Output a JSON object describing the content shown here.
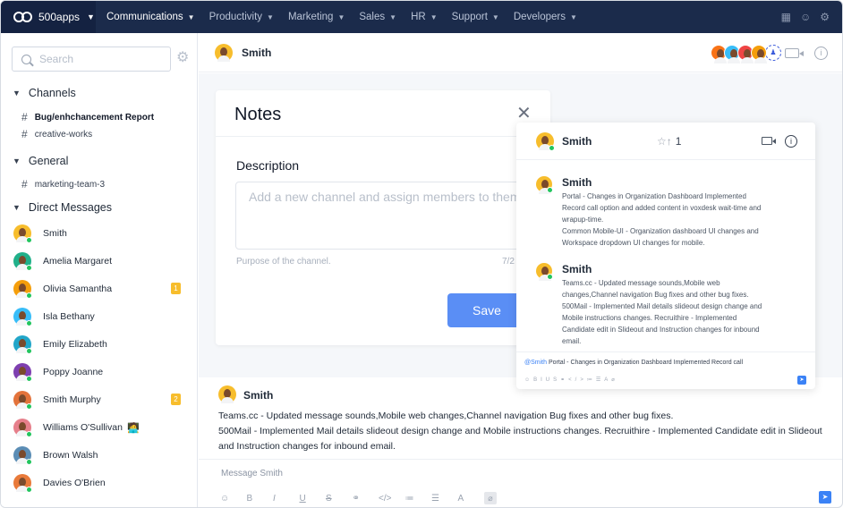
{
  "brand": {
    "name": "500apps"
  },
  "nav": [
    {
      "label": "Communications"
    },
    {
      "label": "Productivity"
    },
    {
      "label": "Marketing"
    },
    {
      "label": "Sales"
    },
    {
      "label": "HR"
    },
    {
      "label": "Support"
    },
    {
      "label": "Developers"
    }
  ],
  "top_icons": [
    "apps-grid-icon",
    "support-icon",
    "gear-icon"
  ],
  "sidebar": {
    "search_placeholder": "Search",
    "channels_title": "Channels",
    "channels": [
      {
        "label": "Bug/enhchancement Report",
        "bold": true
      },
      {
        "label": "creative-works",
        "bold": false
      }
    ],
    "general_title": "General",
    "general": [
      {
        "label": "marketing-team-3"
      }
    ],
    "dm_title": "Direct Messages",
    "dms": [
      {
        "name": "Smith",
        "bg": "#f7bd2c",
        "badge": ""
      },
      {
        "name": "Amelia Margaret",
        "bg": "#20b08a",
        "badge": ""
      },
      {
        "name": "Olivia Samantha",
        "bg": "#f59e0b",
        "badge": "1"
      },
      {
        "name": "Isla Bethany",
        "bg": "#38bdf8",
        "badge": ""
      },
      {
        "name": "Emily Elizabeth",
        "bg": "#22a6c9",
        "badge": ""
      },
      {
        "name": "Poppy Joanne",
        "bg": "#7e3fb0",
        "badge": ""
      },
      {
        "name": "Smith Murphy",
        "bg": "#e3733b",
        "badge": "2"
      },
      {
        "name": "Williams O'Sullivan",
        "bg": "#e67f8b",
        "badge": "",
        "emoji": "🧑‍💻"
      },
      {
        "name": "Brown Walsh",
        "bg": "#5b8db5",
        "badge": ""
      },
      {
        "name": "Davies O'Brien",
        "bg": "#e97a3a",
        "badge": ""
      }
    ]
  },
  "header": {
    "name": "Smith",
    "participant_colors": [
      "#f97316",
      "#38bdf8",
      "#ef4444",
      "#f59e0b"
    ],
    "add_icon": "add-person-icon"
  },
  "notes": {
    "title": "Notes",
    "close": "✕",
    "description_label": "Description",
    "description_placeholder": "Add a new channel and assign members to them.",
    "hint": "Purpose of the channel.",
    "count": "7/2",
    "save": "Save"
  },
  "thread": {
    "name": "Smith",
    "pin_count": "1",
    "messages": [
      {
        "name": "Smith",
        "text": "Portal - Changes in Organization Dashboard Implemented Record call option and added content in voxdesk wait-time and wrapup-time.\nCommon Mobile-UI - Organization dashboard UI changes and Workspace dropdown UI changes for mobile."
      },
      {
        "name": "Smith",
        "text": "Teams.cc - Updated message sounds,Mobile web changes,Channel navigation Bug fixes and other bug fixes. 500Mail - Implemented Mail details slideout design change and Mobile instructions changes. Recruithire - Implemented Candidate edit in Slideout and Instruction changes for inbound email."
      }
    ],
    "input_mention": "@Smith",
    "input_text": " Portal - Changes in Organization Dashboard Implemented Record call"
  },
  "message": {
    "name": "Smith",
    "line1": "Teams.cc - Updated message sounds,Mobile web changes,Channel navigation Bug fixes and other bug fixes.",
    "line2": "500Mail - Implemented Mail details slideout design change and Mobile instructions changes. Recruithire - Implemented Candidate edit in Slideout and Instruction changes for inbound email."
  },
  "composer": {
    "placeholder": "Message Smith",
    "tools": [
      {
        "icon": "emoji-icon",
        "glyph": "☺"
      },
      {
        "icon": "bold-icon",
        "glyph": "B"
      },
      {
        "icon": "italic-icon",
        "glyph": "I"
      },
      {
        "icon": "underline-icon",
        "glyph": "U"
      },
      {
        "icon": "strikethrough-icon",
        "glyph": "S"
      },
      {
        "icon": "link-icon",
        "glyph": "⚭"
      },
      {
        "icon": "code-icon",
        "glyph": "</>"
      },
      {
        "icon": "ordered-list-icon",
        "glyph": "≔"
      },
      {
        "icon": "bullet-list-icon",
        "glyph": "☰"
      },
      {
        "icon": "text-color-icon",
        "glyph": "A"
      },
      {
        "icon": "attach-icon",
        "glyph": "⌀"
      }
    ]
  }
}
